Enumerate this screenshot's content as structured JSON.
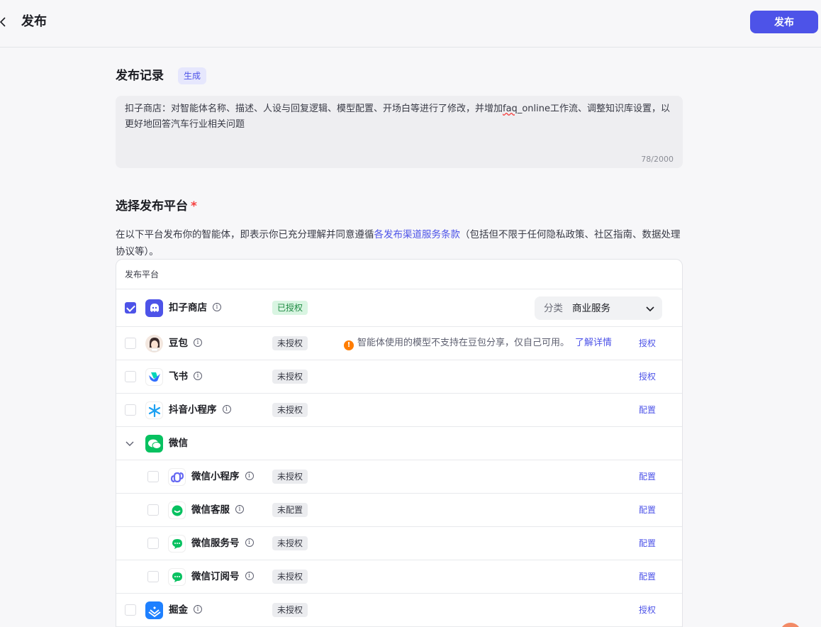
{
  "header": {
    "title": "发布",
    "publish_label": "发布"
  },
  "record": {
    "title": "发布记录",
    "generate_label": "生成",
    "text_before": "扣子商店：对智能体名称、描述、人设与回复逻辑、模型配置、开场白等进行了修改，并增加",
    "text_typo": "faq",
    "text_after": "_online工作流、调整知识库设置，以更好地回答汽车行业相关问题",
    "counter": "78/2000"
  },
  "platforms": {
    "title": "选择发布平台",
    "required": "*",
    "agree_before": "在以下平台发布你的智能体，即表示你已充分理解并同意遵循",
    "agree_link": "各发布渠道服务条款",
    "agree_after": "（包括但不限于任何隐私政策、社区指南、数据处理协议等）。",
    "table_header": "发布平台",
    "info_glyph": "i",
    "rows": {
      "coze": {
        "name": "扣子商店",
        "status": "已授权",
        "category_label": "分类",
        "category_value": "商业服务",
        "checked": true
      },
      "doubao": {
        "name": "豆包",
        "status": "未授权",
        "warn_glyph": "!",
        "warning": "智能体使用的模型不支持在豆包分享，仅自己可用。",
        "warning_link": "了解详情",
        "action": "授权"
      },
      "feishu": {
        "name": "飞书",
        "status": "未授权",
        "action": "授权"
      },
      "douyin": {
        "name": "抖音小程序",
        "status": "未授权",
        "action": "配置"
      },
      "wechat": {
        "name": "微信"
      },
      "wx_mini": {
        "name": "微信小程序",
        "status": "未授权",
        "action": "配置"
      },
      "wx_kf": {
        "name": "微信客服",
        "status": "未配置",
        "action": "配置"
      },
      "wx_service": {
        "name": "微信服务号",
        "status": "未授权",
        "action": "配置"
      },
      "wx_sub": {
        "name": "微信订阅号",
        "status": "未授权",
        "action": "配置"
      },
      "juejin": {
        "name": "掘金",
        "status": "未授权",
        "action": "授权"
      }
    }
  },
  "colors": {
    "primary": "#4d53e8",
    "authorized_bg": "#d9f5e2",
    "authorized_text": "#1e8a42",
    "warning": "#ff7d00",
    "wechat_green": "#07c160"
  }
}
